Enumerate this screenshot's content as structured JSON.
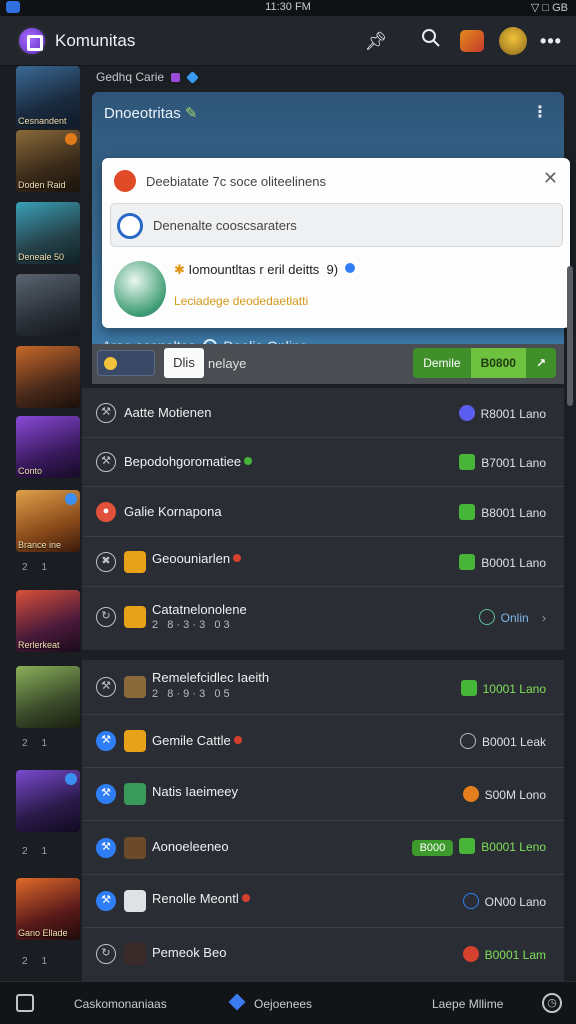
{
  "status_bar": {
    "time": "11:30 FM",
    "right": "▽ □ GB"
  },
  "app": {
    "title": "Komunitas"
  },
  "sidebar": {
    "thumbs": [
      {
        "label": "Cesnandent"
      },
      {
        "label": "Doden Raid"
      },
      {
        "label": "Deneale 50"
      },
      {
        "label": ""
      },
      {
        "label": ""
      },
      {
        "label": "Conto"
      },
      {
        "label": "Brance ine"
      },
      {
        "label": "Rerlerkeat"
      },
      {
        "label": ""
      },
      {
        "label": ""
      },
      {
        "label": "Gano Ellade"
      }
    ]
  },
  "breadcrumb": "Gedhq Carie",
  "band": {
    "title": "Dnoeotritas",
    "footer_left": "Aree ocenaltas",
    "footer_right": "Doelia Online"
  },
  "dialog": {
    "header": "Deebiatate 7c soce oliteelinens",
    "field": "Denenalte cooscsaraters",
    "item_title": "Iomountltas r eril deitts  9)",
    "item_sub": "Leciadege deodedaetlatti"
  },
  "filter": {
    "input": "Dlis",
    "label": "nelaye",
    "btn1": "Demile",
    "btn2": "B0800",
    "btn3": "↗"
  },
  "rows_card1": [
    {
      "title": "Aatte Motienen",
      "status": "R8001 Lano",
      "icon": "violet"
    },
    {
      "title": "Bepodohgoromatiee",
      "status": "B7001 Lano",
      "icon": "green"
    },
    {
      "title": "Galie Kornapona",
      "status": "B8001 Lano",
      "icon": "green"
    },
    {
      "title": "Geoouniarlen",
      "status": "B0001 Lano",
      "icon": "green"
    },
    {
      "title": "Catatnelonolene",
      "sub": "2   8 · 3 · 3   0 3",
      "status": "Onlin"
    }
  ],
  "rows_card2": [
    {
      "title": "Remelefcidlec Iaeith",
      "sub": "2   8 · 9 · 3   0 5",
      "status": "10001 Lano",
      "icon": "green"
    },
    {
      "title": "Gemile Cattle",
      "status": "B0001 Leak",
      "icon": "ring"
    },
    {
      "title": "Natis Iaeimeey",
      "status": "S00M Lono",
      "icon": "orange"
    },
    {
      "title": "Aonoeleeneo",
      "pill": "B000",
      "status": "B0001 Leno",
      "icon": "green"
    },
    {
      "title": "Renolle Meontl",
      "status": "ON00 Lano",
      "icon": "ring"
    },
    {
      "title": "Pemeok Beo",
      "status": "B0001 Lam",
      "icon": "red"
    }
  ],
  "bottom_nav": {
    "left": "Caskomonaniaas",
    "middle": "Oejoenees",
    "right": "Laepe Mllime"
  }
}
